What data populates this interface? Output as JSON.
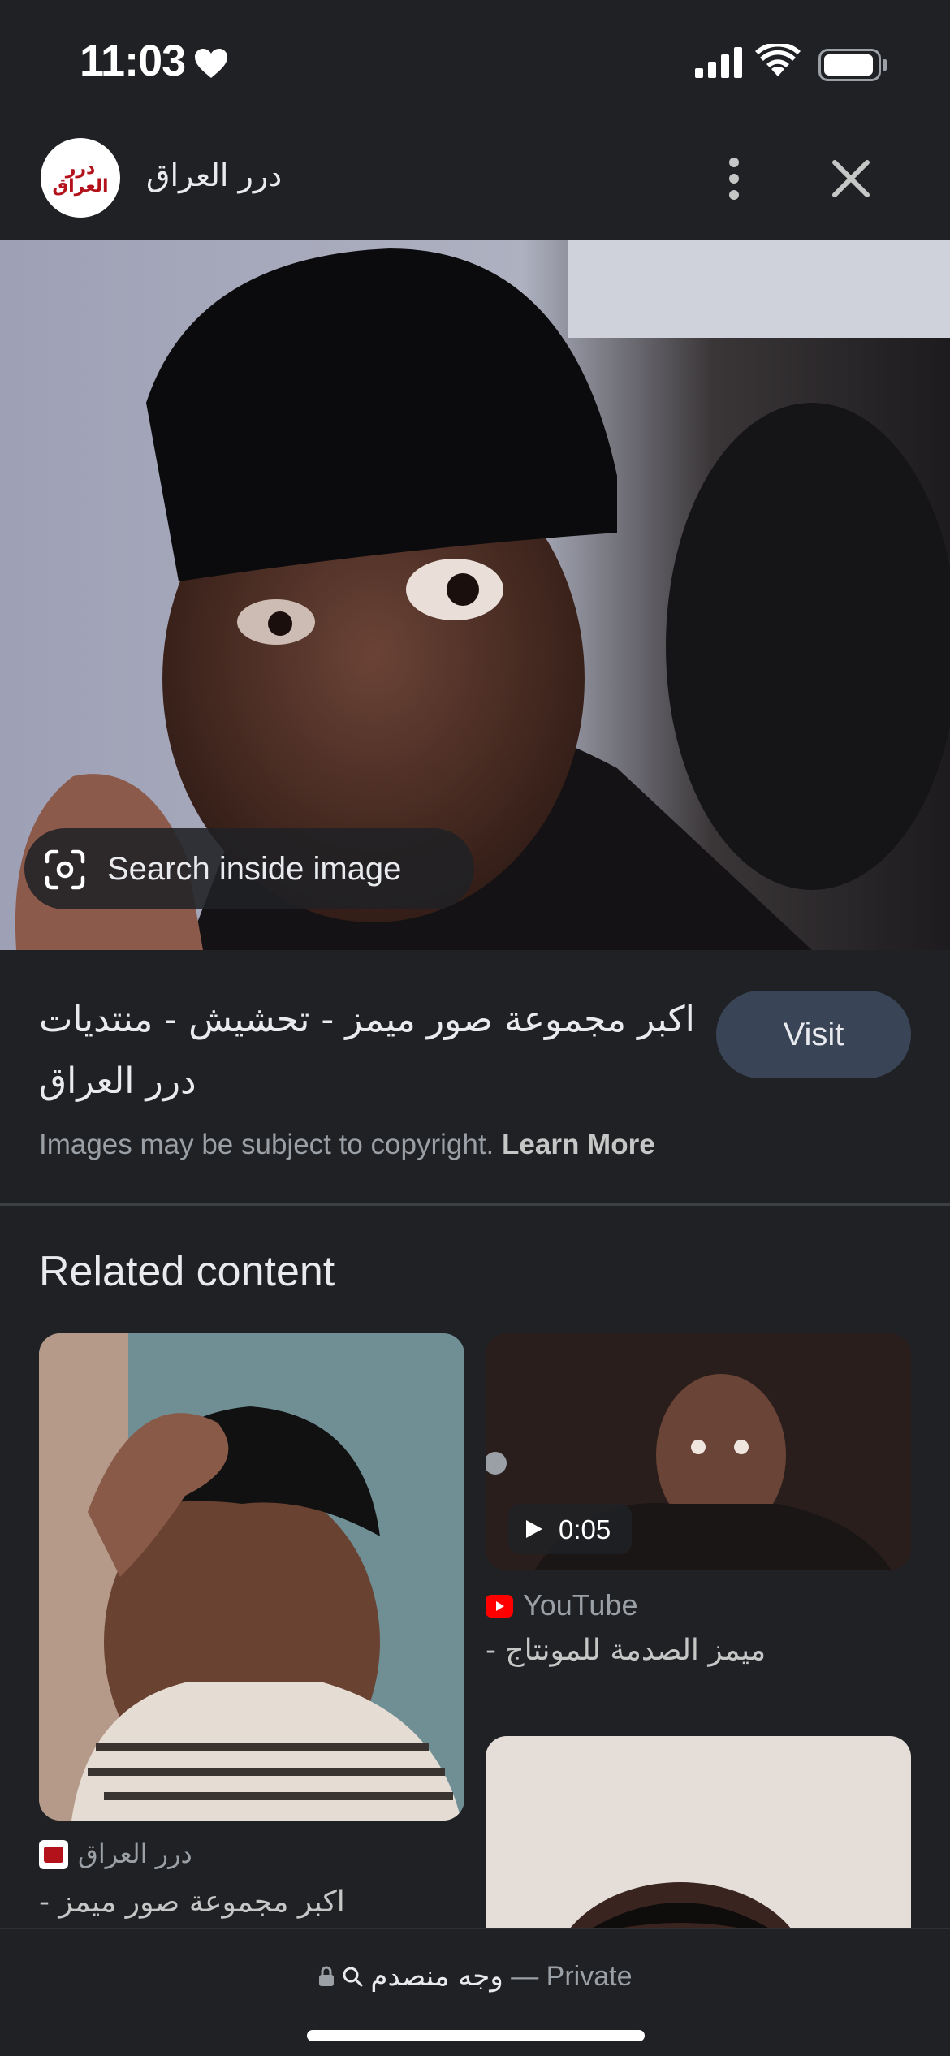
{
  "status_bar": {
    "time": "11:03"
  },
  "header": {
    "logo_text": "درر العراق",
    "site_name": "درر العراق"
  },
  "image_overlay": {
    "search_inside_label": "Search inside image"
  },
  "result": {
    "title": "اكبر مجموعة صور ميمز - تحشيش - منتديات درر العراق",
    "visit_label": "Visit",
    "copyright_text": "Images may be subject to copyright.",
    "learn_more": "Learn More"
  },
  "related": {
    "heading": "Related content",
    "items": [
      {
        "source": "درر العراق",
        "title": "اكبر مجموعة صور ميمز -"
      },
      {
        "source": "YouTube",
        "title": "ميمز الصدمة للمونتاج -",
        "duration": "0:05"
      }
    ]
  },
  "bottom_bar": {
    "query": "وجه منصدم",
    "separator": "—",
    "mode": "Private"
  },
  "colors": {
    "background": "#202124",
    "visit_button": "#394457",
    "youtube_red": "#ff0000"
  }
}
